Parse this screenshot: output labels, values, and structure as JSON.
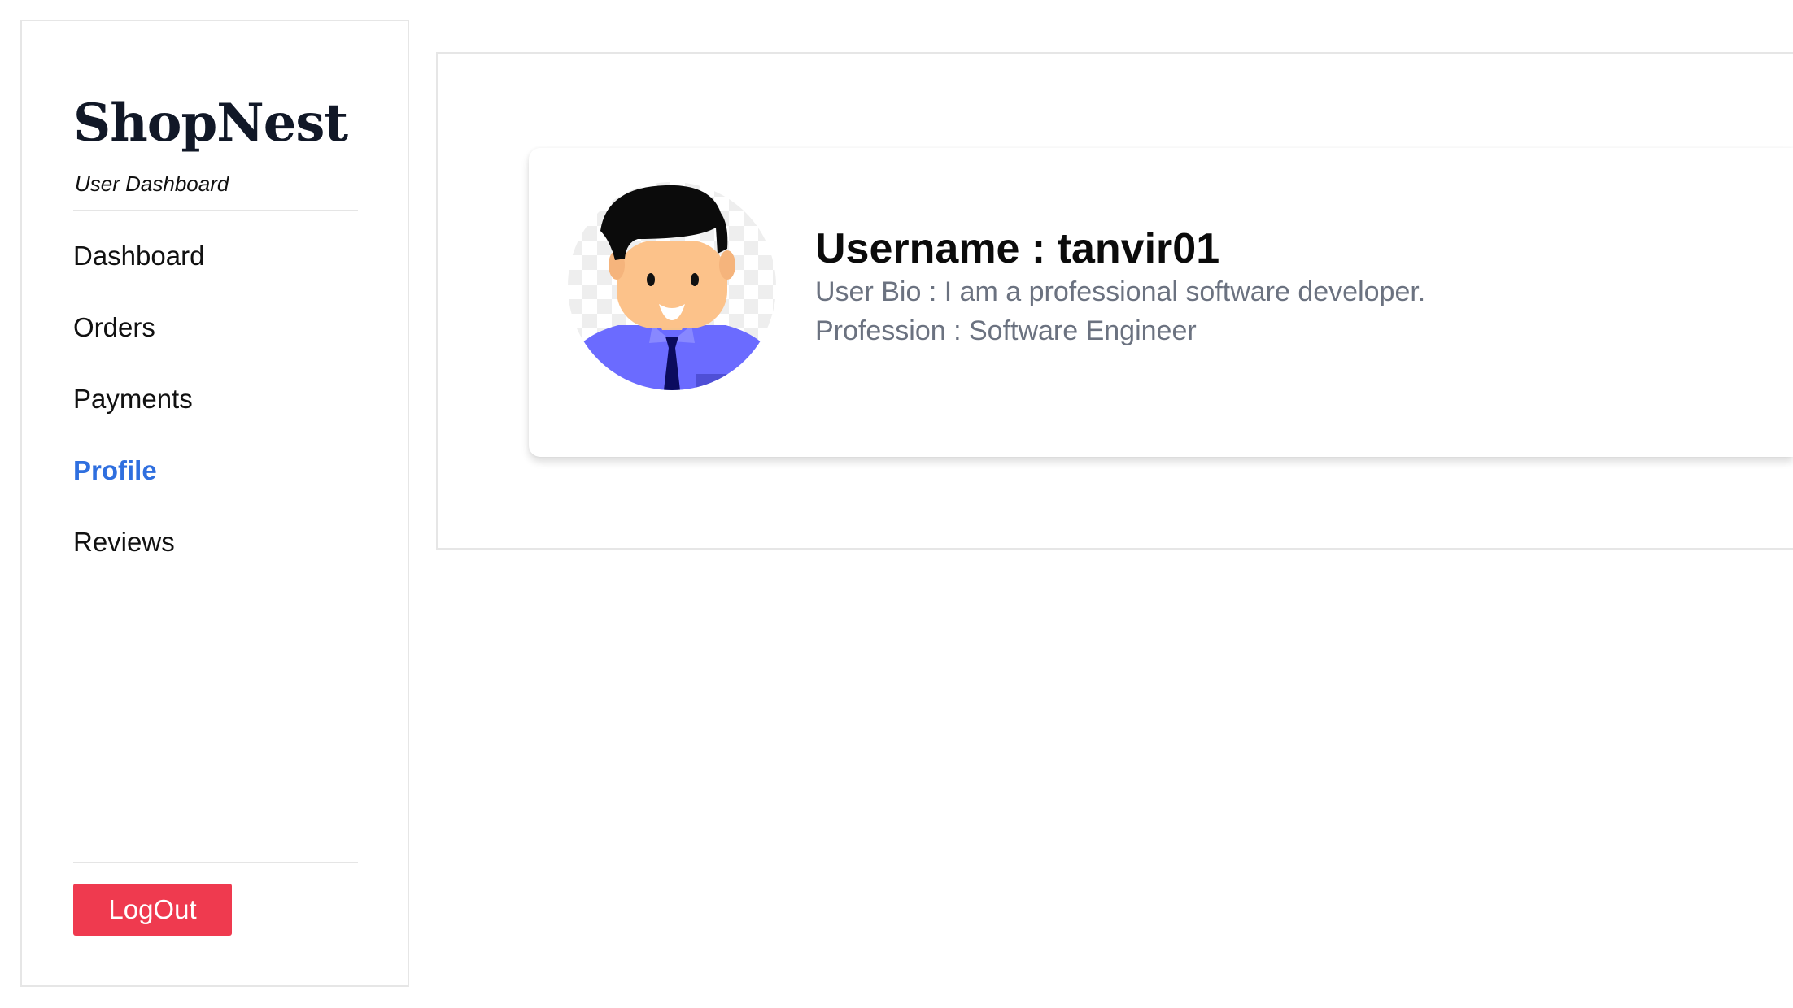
{
  "sidebar": {
    "brand": "ShopNest",
    "subtitle": "User Dashboard",
    "nav": [
      {
        "label": "Dashboard",
        "active": false
      },
      {
        "label": "Orders",
        "active": false
      },
      {
        "label": "Payments",
        "active": false
      },
      {
        "label": "Profile",
        "active": true
      },
      {
        "label": "Reviews",
        "active": false
      }
    ],
    "logout_label": "LogOut"
  },
  "profile": {
    "avatar_icon": "user-avatar-illustration",
    "username": "Username : tanvir01",
    "bio": "User Bio : I am a professional software developer.",
    "profession": "Profession : Software Engineer"
  },
  "colors": {
    "accent": "#2f6fdf",
    "logout": "#ef3a4f",
    "muted_text": "#6b7280",
    "border": "#e6e6e6"
  }
}
